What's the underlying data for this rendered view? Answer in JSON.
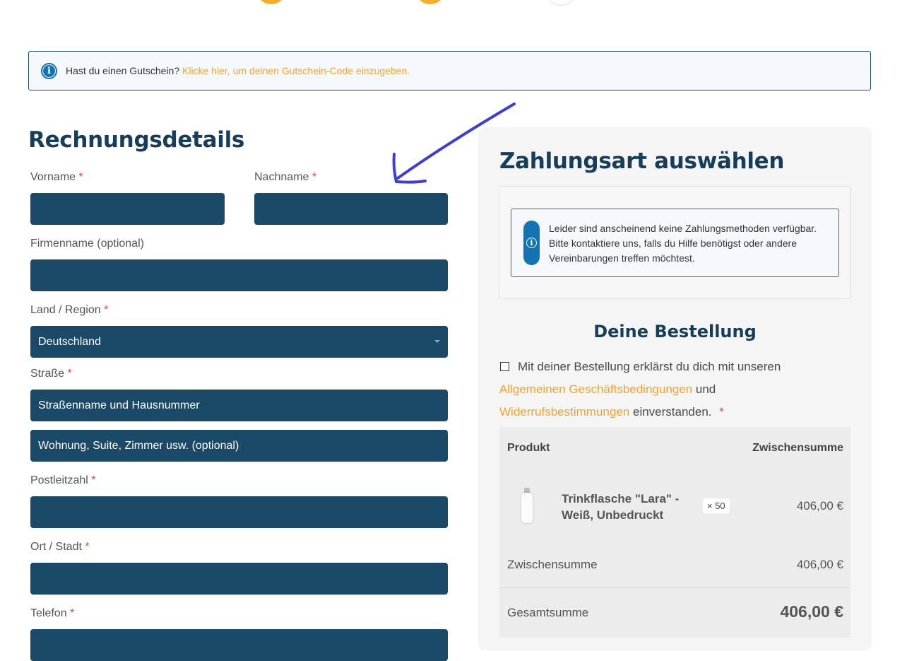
{
  "coupon": {
    "text": "Hast du einen Gutschein?",
    "link": "Klicke hier, um deinen Gutschein-Code einzugeben."
  },
  "billing": {
    "title": "Rechnungsdetails",
    "first_name_label": "Vorname",
    "last_name_label": "Nachname",
    "company_label": "Firmenname (optional)",
    "country_label": "Land / Region",
    "country_value": "Deutschland",
    "street_label": "Straße",
    "street_placeholder": "Straßenname und Hausnummer",
    "street2_placeholder": "Wohnung, Suite, Zimmer usw. (optional)",
    "zip_label": "Postleitzahl",
    "city_label": "Ort / Stadt",
    "phone_label": "Telefon",
    "required_mark": "*"
  },
  "payment": {
    "title": "Zahlungsart auswählen",
    "notice": "Leider sind anscheinend keine Zahlungsmethoden verfügbar. Bitte kontaktiere uns, falls du Hilfe benötigst oder andere Vereinbarungen treffen möchtest."
  },
  "order": {
    "title": "Deine Bestellung",
    "terms_prefix": "Mit deiner Bestellung erklärst du dich mit unseren",
    "terms_link1": "Allgemeinen Geschäftsbedingungen",
    "terms_and": "und",
    "terms_link2": "Widerrufsbestimmungen",
    "terms_suffix": "einverstanden.",
    "col_product": "Produkt",
    "col_subtotal": "Zwischensumme",
    "item_name": "Trinkflasche \"Lara\" - Weiß, Unbedruckt",
    "item_qty": "× 50",
    "item_price": "406,00 €",
    "subtotal_label": "Zwischensumme",
    "subtotal_value": "406,00 €",
    "total_label": "Gesamtsumme",
    "total_value": "406,00 €"
  },
  "colors": {
    "field_bg": "#1a4a68",
    "heading": "#163d59",
    "accent": "#f5a12a",
    "info": "#1373b3",
    "annotation_arrow": "#3f3fcf"
  }
}
